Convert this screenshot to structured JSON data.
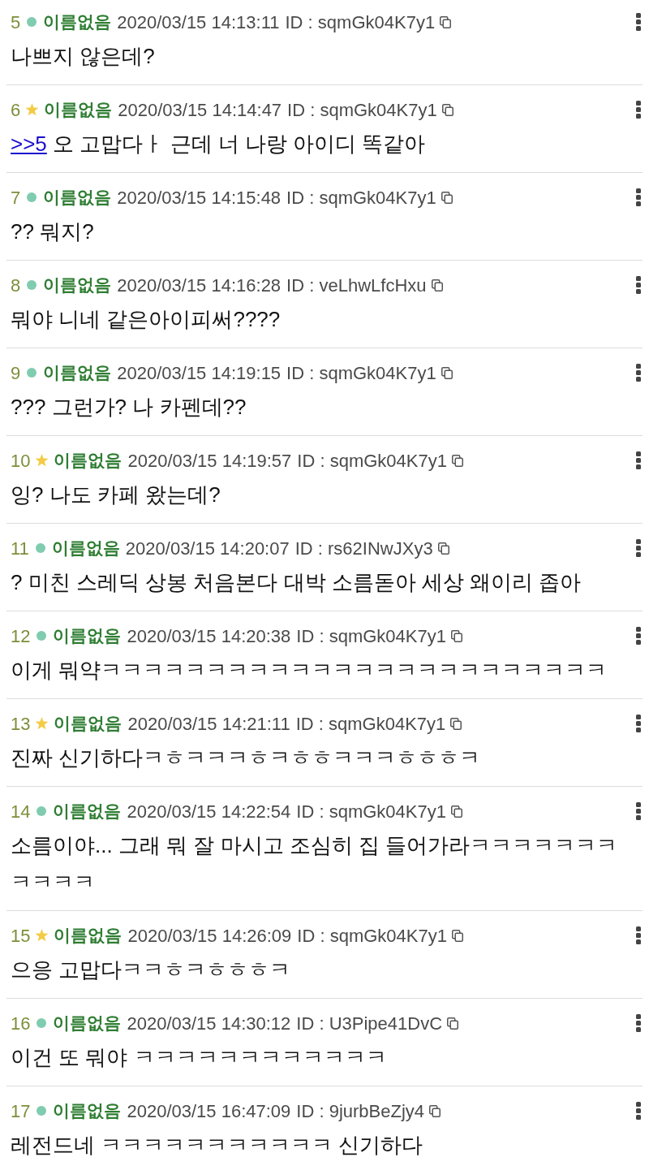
{
  "posts": [
    {
      "number": "5",
      "starred": false,
      "name": "이름없음",
      "datetime": "2020/03/15 14:13:11",
      "id_text": "ID : sqmGk04K7y1",
      "body": "나쁘지 않은데?"
    },
    {
      "number": "6",
      "starred": true,
      "name": "이름없음",
      "datetime": "2020/03/15 14:14:47",
      "id_text": "ID : sqmGk04K7y1",
      "reply_link": ">>5",
      "body": "오 고맙다ㅏ 근데 너 나랑 아이디 똑같아"
    },
    {
      "number": "7",
      "starred": false,
      "name": "이름없음",
      "datetime": "2020/03/15 14:15:48",
      "id_text": "ID : sqmGk04K7y1",
      "body": "?? 뭐지?"
    },
    {
      "number": "8",
      "starred": false,
      "name": "이름없음",
      "datetime": "2020/03/15 14:16:28",
      "id_text": "ID : veLhwLfcHxu",
      "body": "뭐야 니네 같은아이피써????"
    },
    {
      "number": "9",
      "starred": false,
      "name": "이름없음",
      "datetime": "2020/03/15 14:19:15",
      "id_text": "ID : sqmGk04K7y1",
      "body": "??? 그런가? 나 카펜데??"
    },
    {
      "number": "10",
      "starred": true,
      "name": "이름없음",
      "datetime": "2020/03/15 14:19:57",
      "id_text": "ID : sqmGk04K7y1",
      "body": "잉? 나도 카페 왔는데?"
    },
    {
      "number": "11",
      "starred": false,
      "name": "이름없음",
      "datetime": "2020/03/15 14:20:07",
      "id_text": "ID : rs62INwJXy3",
      "body": "? 미친 스레딕 상봉 처음본다 대박 소름돋아 세상 왜이리 좁아"
    },
    {
      "number": "12",
      "starred": false,
      "name": "이름없음",
      "datetime": "2020/03/15 14:20:38",
      "id_text": "ID : sqmGk04K7y1",
      "body": "이게 뭐약ㅋㅋㅋㅋㅋㅋㅋㅋㅋㅋㅋㅋㅋㅋㅋㅋㅋㅋㅋㅋㅋㅋㅋㅋ"
    },
    {
      "number": "13",
      "starred": true,
      "name": "이름없음",
      "datetime": "2020/03/15 14:21:11",
      "id_text": "ID : sqmGk04K7y1",
      "body": "진짜 신기하다ㅋㅎㅋㅋㅋㅎㅋㅎㅎㅋㅋㅋㅎㅎㅎㅋ"
    },
    {
      "number": "14",
      "starred": false,
      "name": "이름없음",
      "datetime": "2020/03/15 14:22:54",
      "id_text": "ID : sqmGk04K7y1",
      "body": "소름이야... 그래 뭐 잘 마시고 조심히 집 들어가라ㅋㅋㅋㅋㅋㅋㅋㅋㅋㅋㅋ"
    },
    {
      "number": "15",
      "starred": true,
      "name": "이름없음",
      "datetime": "2020/03/15 14:26:09",
      "id_text": "ID : sqmGk04K7y1",
      "body": "으응 고맙다ㅋㅋㅎㅋㅎㅎㅎㅋ"
    },
    {
      "number": "16",
      "starred": false,
      "name": "이름없음",
      "datetime": "2020/03/15 14:30:12",
      "id_text": "ID : U3Pipe41DvC",
      "body": "이건 또 뭐야 ㅋㅋㅋㅋㅋㅋㅋㅋㅋㅋㅋㅋ"
    },
    {
      "number": "17",
      "starred": false,
      "name": "이름없음",
      "datetime": "2020/03/15 16:47:09",
      "id_text": "ID : 9jurbBeZjy4",
      "body": "레전드네 ㅋㅋㅋㅋㅋㅋㅋㅋㅋㅋㅋ 신기하다"
    }
  ]
}
